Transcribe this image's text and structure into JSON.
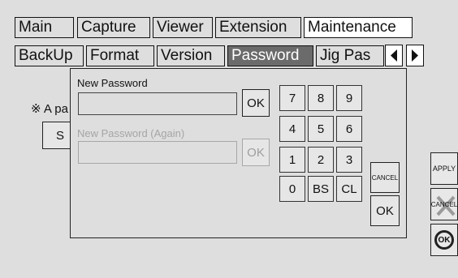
{
  "tabs_row1": [
    "Main",
    "Capture",
    "Viewer",
    "Extension",
    "Maintenance"
  ],
  "tabs_row2": [
    "BackUp",
    "Format",
    "Version",
    "Password",
    "Jig Pas"
  ],
  "arrows": {
    "left": "◀",
    "right": "▶"
  },
  "background": {
    "note_text": "※ A pa",
    "button_partial": "S"
  },
  "dialog": {
    "new_password_label": "New Password",
    "new_password_value": "",
    "ok_label": "OK",
    "new_password_again_label": "New Password (Again)",
    "new_password_again_value": "",
    "ok2_label": "OK",
    "keypad": [
      "7",
      "8",
      "9",
      "4",
      "5",
      "6",
      "1",
      "2",
      "3",
      "0",
      "BS",
      "CL"
    ],
    "cancel_label": "CANCEL",
    "keypad_ok_label": "OK"
  },
  "right_panel": {
    "apply_label": "APPLY",
    "cancel_label": "CANCEL",
    "ok_label": "OK"
  }
}
